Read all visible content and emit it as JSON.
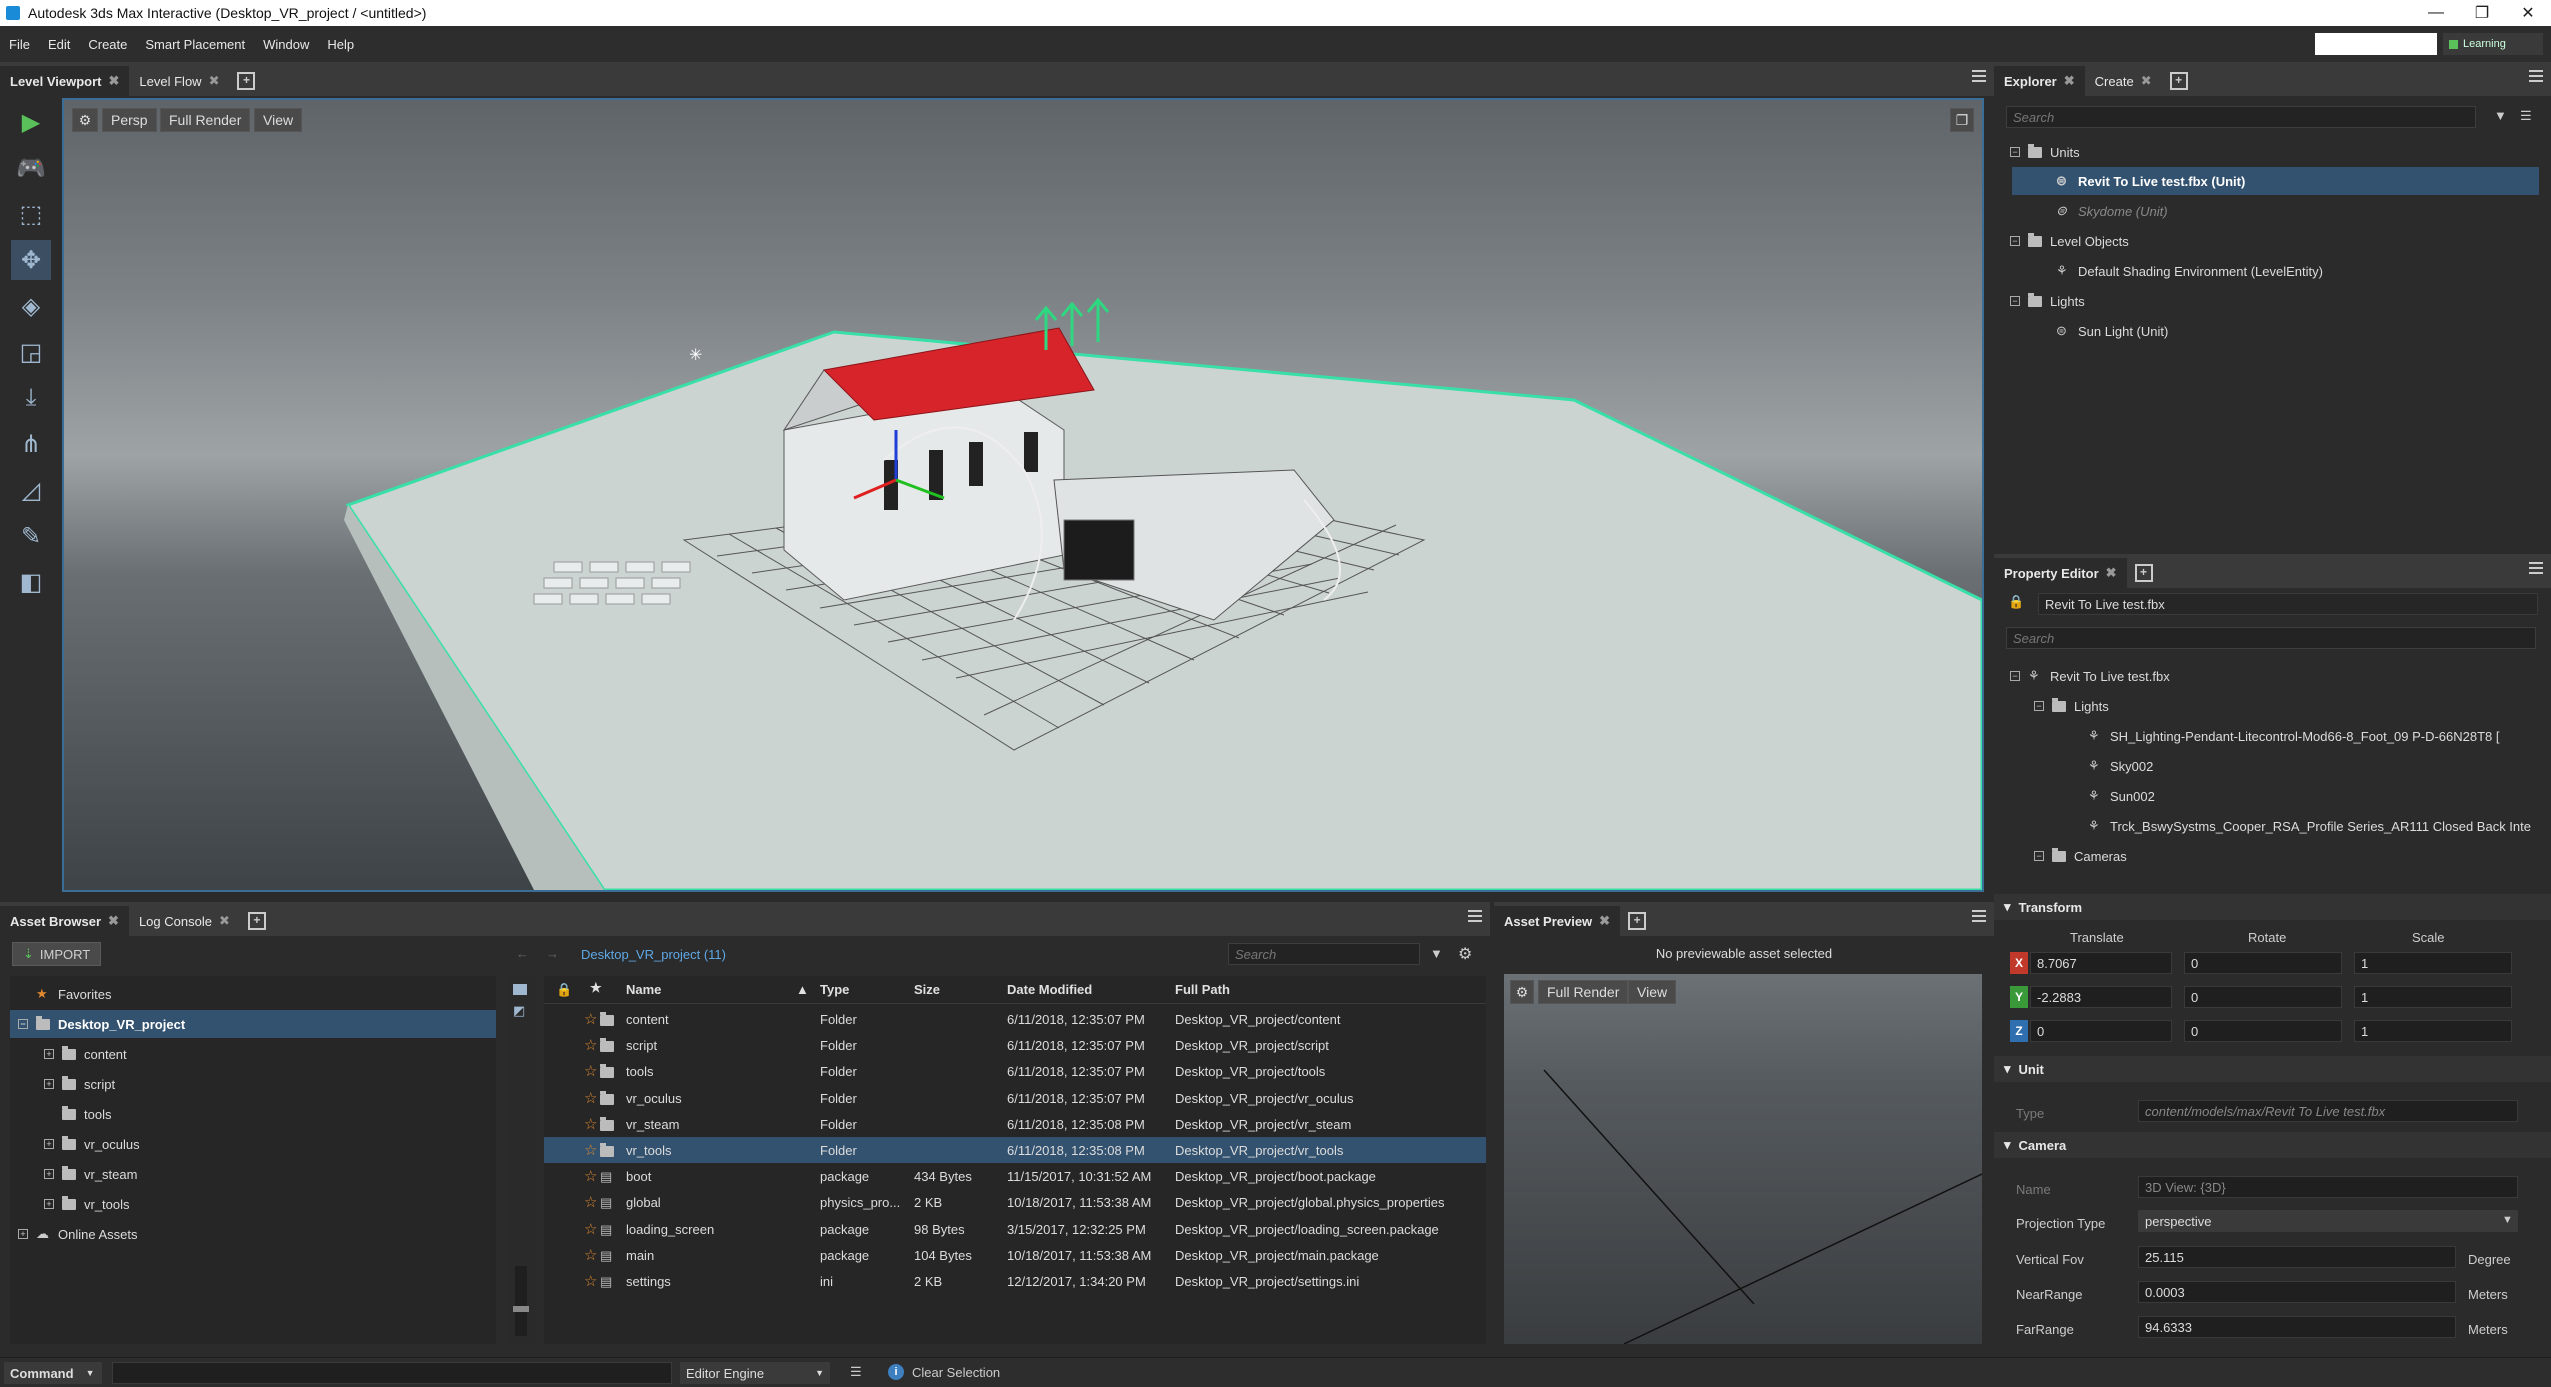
{
  "window": {
    "title": "Autodesk 3ds Max Interactive (Desktop_VR_project / <untitled>)",
    "minimize": "—",
    "maximize": "❐",
    "close": "✕",
    "learning_label": "Learning"
  },
  "menu": [
    "File",
    "Edit",
    "Create",
    "Smart Placement",
    "Window",
    "Help"
  ],
  "viewport_panel": {
    "tabs": [
      "Level Viewport",
      "Level Flow"
    ],
    "buttons": {
      "persp": "Persp",
      "full_render": "Full Render",
      "view": "View"
    }
  },
  "explorer": {
    "tabs": [
      "Explorer",
      "Create"
    ],
    "search_placeholder": "Search",
    "groups": [
      {
        "label": "Units",
        "items": [
          {
            "label": "Revit To Live test.fbx (Unit)",
            "selected": true
          },
          {
            "label": "Skydome (Unit)",
            "dim": true
          }
        ]
      },
      {
        "label": "Level Objects",
        "items": [
          {
            "label": "Default Shading Environment (LevelEntity)"
          }
        ]
      },
      {
        "label": "Lights",
        "items": [
          {
            "label": "Sun Light (Unit)"
          }
        ]
      }
    ]
  },
  "property_editor": {
    "tab": "Property Editor",
    "object_name": "Revit To Live test.fbx",
    "search_placeholder": "Search",
    "tree": [
      {
        "label": "Revit To Live test.fbx",
        "level": 0
      },
      {
        "label": "Lights",
        "level": 1
      },
      {
        "label": "SH_Lighting-Pendant-Litecontrol-Mod66-8_Foot_09 P-D-66N28T8 [",
        "level": 2
      },
      {
        "label": "Sky002",
        "level": 2
      },
      {
        "label": "Sun002",
        "level": 2
      },
      {
        "label": "Trck_BswySystms_Cooper_RSA_Profile Series_AR111 Closed Back Inte",
        "level": 2
      },
      {
        "label": "Cameras",
        "level": 1
      }
    ],
    "transform": {
      "header": "Transform",
      "col_translate": "Translate",
      "col_rotate": "Rotate",
      "col_scale": "Scale",
      "rows": [
        {
          "axis": "X",
          "color": "#c0392b",
          "translate": "8.7067",
          "rotate": "0",
          "scale": "1"
        },
        {
          "axis": "Y",
          "color": "#3a9a3a",
          "translate": "-2.2883",
          "rotate": "0",
          "scale": "1"
        },
        {
          "axis": "Z",
          "color": "#2f6fb0",
          "translate": "0",
          "rotate": "0",
          "scale": "1"
        }
      ]
    },
    "unit": {
      "header": "Unit",
      "type_label": "Type",
      "type_value": "content/models/max/Revit To Live test.fbx"
    },
    "camera": {
      "header": "Camera",
      "name_label": "Name",
      "name_value": "3D View: {3D}",
      "proj_label": "Projection Type",
      "proj_value": "perspective",
      "fov_label": "Vertical Fov",
      "fov_value": "25.115",
      "fov_unit": "Degree",
      "near_label": "NearRange",
      "near_value": "0.0003",
      "near_unit": "Meters",
      "far_label": "FarRange",
      "far_value": "94.6333",
      "far_unit": "Meters"
    }
  },
  "asset_browser": {
    "tabs": [
      "Asset Browser",
      "Log Console"
    ],
    "import_label": "IMPORT",
    "breadcrumb": "Desktop_VR_project (11)",
    "search_placeholder": "Search",
    "folder_tree": [
      {
        "label": "Favorites",
        "level": 0,
        "icon": "star"
      },
      {
        "label": "Desktop_VR_project",
        "level": 0,
        "icon": "folder",
        "selected": true,
        "expander": "−"
      },
      {
        "label": "content",
        "level": 1,
        "icon": "folder",
        "expander": "+"
      },
      {
        "label": "script",
        "level": 1,
        "icon": "folder",
        "expander": "+"
      },
      {
        "label": "tools",
        "level": 1,
        "icon": "folder"
      },
      {
        "label": "vr_oculus",
        "level": 1,
        "icon": "folder",
        "expander": "+"
      },
      {
        "label": "vr_steam",
        "level": 1,
        "icon": "folder",
        "expander": "+"
      },
      {
        "label": "vr_tools",
        "level": 1,
        "icon": "folder",
        "expander": "+"
      },
      {
        "label": "Online Assets",
        "level": 0,
        "icon": "cloud",
        "expander": "+"
      }
    ],
    "columns": {
      "name": "Name",
      "type": "Type",
      "size": "Size",
      "date": "Date Modified",
      "path": "Full Path"
    },
    "rows": [
      {
        "name": "content",
        "kind": "folder",
        "type": "Folder",
        "size": "",
        "date": "6/11/2018, 12:35:07 PM",
        "path": "Desktop_VR_project/content"
      },
      {
        "name": "script",
        "kind": "folder",
        "type": "Folder",
        "size": "",
        "date": "6/11/2018, 12:35:07 PM",
        "path": "Desktop_VR_project/script"
      },
      {
        "name": "tools",
        "kind": "folder",
        "type": "Folder",
        "size": "",
        "date": "6/11/2018, 12:35:07 PM",
        "path": "Desktop_VR_project/tools"
      },
      {
        "name": "vr_oculus",
        "kind": "folder",
        "type": "Folder",
        "size": "",
        "date": "6/11/2018, 12:35:07 PM",
        "path": "Desktop_VR_project/vr_oculus"
      },
      {
        "name": "vr_steam",
        "kind": "folder",
        "type": "Folder",
        "size": "",
        "date": "6/11/2018, 12:35:08 PM",
        "path": "Desktop_VR_project/vr_steam"
      },
      {
        "name": "vr_tools",
        "kind": "folder",
        "type": "Folder",
        "size": "",
        "date": "6/11/2018, 12:35:08 PM",
        "path": "Desktop_VR_project/vr_tools",
        "selected": true
      },
      {
        "name": "boot",
        "kind": "file",
        "type": "package",
        "size": "434 Bytes",
        "date": "11/15/2017, 10:31:52 AM",
        "path": "Desktop_VR_project/boot.package"
      },
      {
        "name": "global",
        "kind": "file",
        "type": "physics_pro...",
        "size": "2 KB",
        "date": "10/18/2017, 11:53:38 AM",
        "path": "Desktop_VR_project/global.physics_properties"
      },
      {
        "name": "loading_screen",
        "kind": "file",
        "type": "package",
        "size": "98 Bytes",
        "date": "3/15/2017, 12:32:25 PM",
        "path": "Desktop_VR_project/loading_screen.package"
      },
      {
        "name": "main",
        "kind": "file",
        "type": "package",
        "size": "104 Bytes",
        "date": "10/18/2017, 11:53:38 AM",
        "path": "Desktop_VR_project/main.package"
      },
      {
        "name": "settings",
        "kind": "file",
        "type": "ini",
        "size": "2 KB",
        "date": "12/12/2017, 1:34:20 PM",
        "path": "Desktop_VR_project/settings.ini"
      }
    ]
  },
  "asset_preview": {
    "tab": "Asset Preview",
    "message": "No previewable asset selected",
    "full_render": "Full Render",
    "view": "View"
  },
  "statusbar": {
    "command_label": "Command",
    "engine_label": "Editor Engine",
    "clear_selection": "Clear Selection"
  },
  "colors": {
    "accent": "#3a6e96",
    "selection": "#33526f",
    "star": "#e0892e",
    "roof": "#d6242a",
    "outline": "#38e0a8"
  }
}
